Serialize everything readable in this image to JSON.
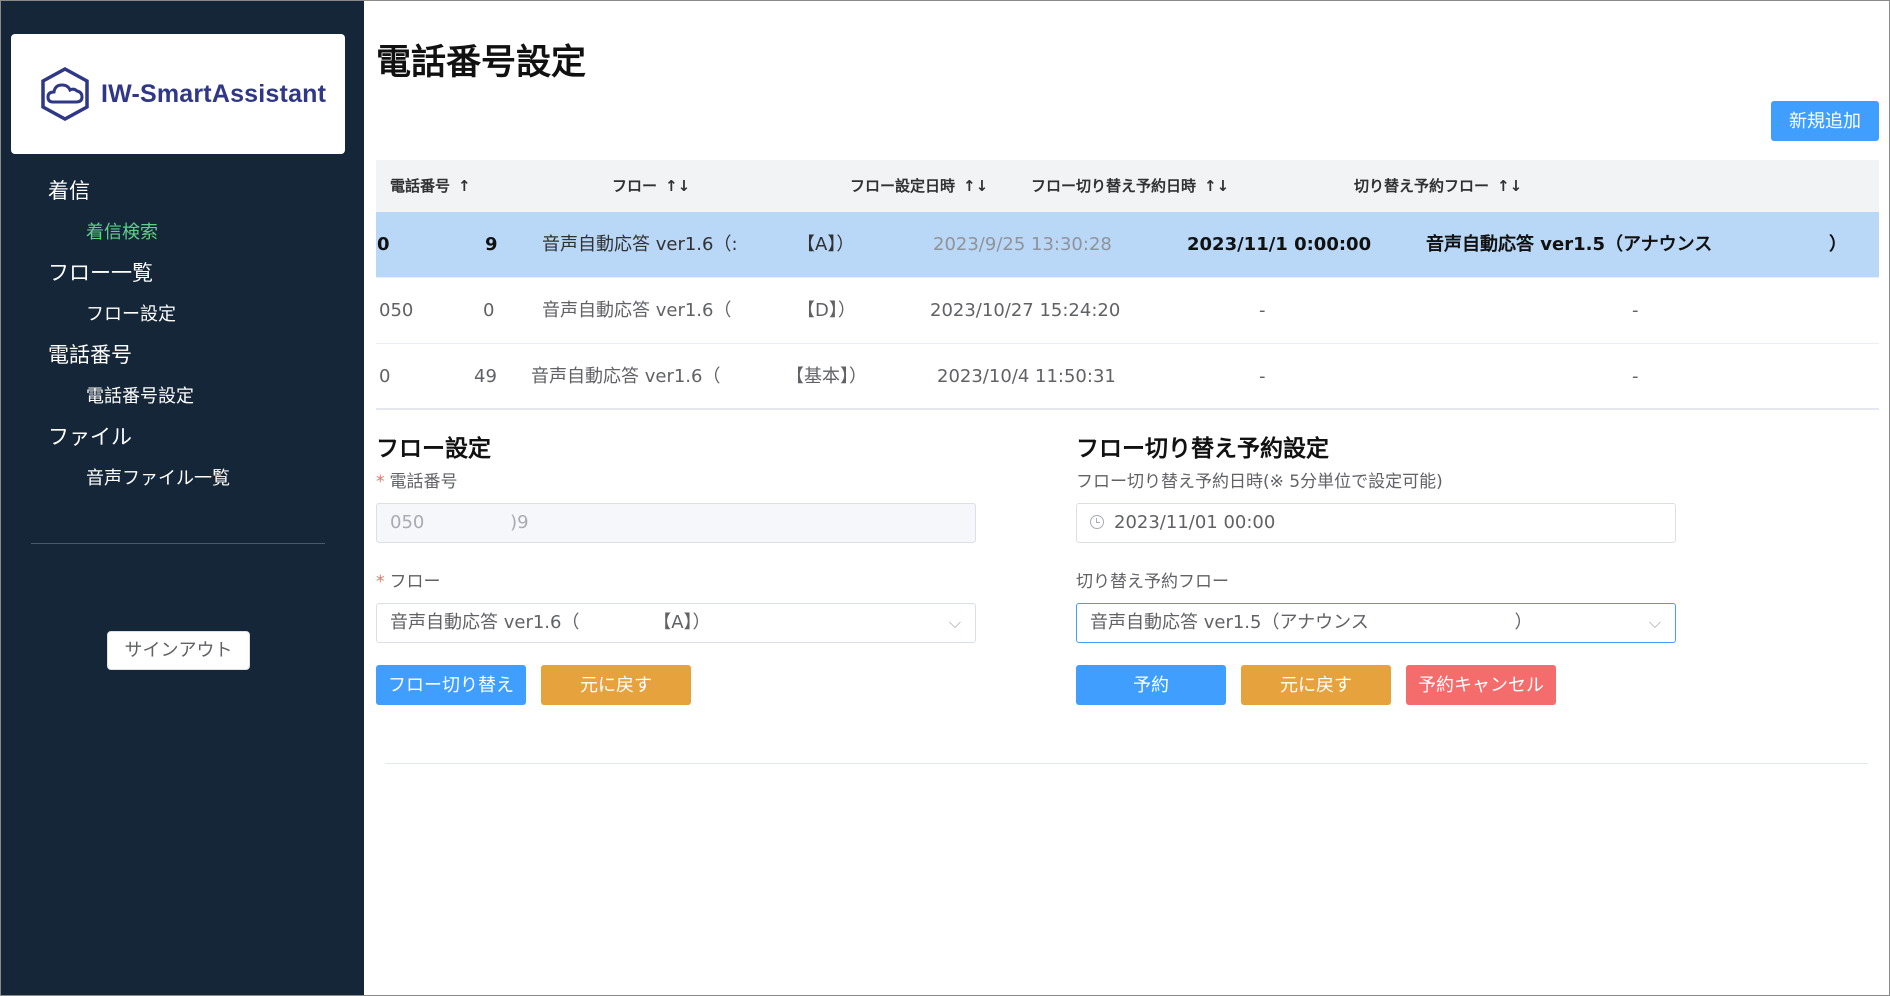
{
  "brand": {
    "name": "IW-SmartAssistant"
  },
  "sidebar": {
    "items": [
      {
        "label": "着信",
        "children": [
          {
            "label": "着信検索",
            "active": true
          }
        ]
      },
      {
        "label": "フロー一覧",
        "children": [
          {
            "label": "フロー設定",
            "active": false
          }
        ]
      },
      {
        "label": "電話番号",
        "children": [
          {
            "label": "電話番号設定",
            "active": false
          }
        ]
      },
      {
        "label": "ファイル",
        "children": [
          {
            "label": "音声ファイル一覧",
            "active": false
          }
        ]
      }
    ],
    "signout_label": "サインアウト"
  },
  "page": {
    "title": "電話番号設定",
    "new_button": "新規追加"
  },
  "table": {
    "headers": [
      {
        "label": "電話番号",
        "sort": "↑"
      },
      {
        "label": "フロー",
        "sort": "↑↓"
      },
      {
        "label": "フロー設定日時",
        "sort": "↑↓"
      },
      {
        "label": "フロー切り替え予約日時",
        "sort": "↑↓"
      },
      {
        "label": "切り替え予約フロー",
        "sort": "↑↓"
      }
    ],
    "rows": [
      {
        "phone_a": "0",
        "phone_b": "9",
        "flow_a": "音声自動応答 ver1.6（:",
        "flow_b": "【A】）",
        "set_at": "2023/9/25 13:30:28",
        "reserve_at": "2023/11/1 0:00:00",
        "reserve_flow_a": "音声自動応答 ver1.5（アナウンス",
        "reserve_flow_b": "）",
        "selected": true
      },
      {
        "phone_a": "050",
        "phone_b": "0",
        "flow_a": "音声自動応答 ver1.6（",
        "flow_b": "【D】）",
        "set_at": "2023/10/27 15:24:20",
        "reserve_at": "-",
        "reserve_flow_a": "-",
        "reserve_flow_b": "",
        "selected": false
      },
      {
        "phone_a": "0",
        "phone_b": "49",
        "flow_a": "音声自動応答 ver1.6（",
        "flow_b": "【基本】）",
        "set_at": "2023/10/4 11:50:31",
        "reserve_at": "-",
        "reserve_flow_a": "-",
        "reserve_flow_b": "",
        "selected": false
      }
    ]
  },
  "flow_form": {
    "title": "フロー設定",
    "phone_label": "電話番号",
    "phone_value_a": "050",
    "phone_value_b": ")9",
    "flow_label": "フロー",
    "flow_value_a": "音声自動応答 ver1.6（",
    "flow_value_b": "【A】）",
    "switch_button": "フロー切り替え",
    "revert_button": "元に戻す"
  },
  "reserve_form": {
    "title": "フロー切り替え予約設定",
    "datetime_label": "フロー切り替え予約日時(※ 5分単位で設定可能)",
    "datetime_value": "2023/11/01 00:00",
    "flow_label": "切り替え予約フロー",
    "flow_value_a": "音声自動応答 ver1.5（アナウンス",
    "flow_value_b": "）",
    "reserve_button": "予約",
    "revert_button": "元に戻す",
    "cancel_button": "予約キャンセル"
  },
  "colors": {
    "sidebar_bg": "#142638",
    "active_nav": "#5fd089",
    "primary": "#409eff",
    "warning": "#e6a23c",
    "danger": "#f56c6c",
    "selected_row": "#b9d7f6"
  }
}
